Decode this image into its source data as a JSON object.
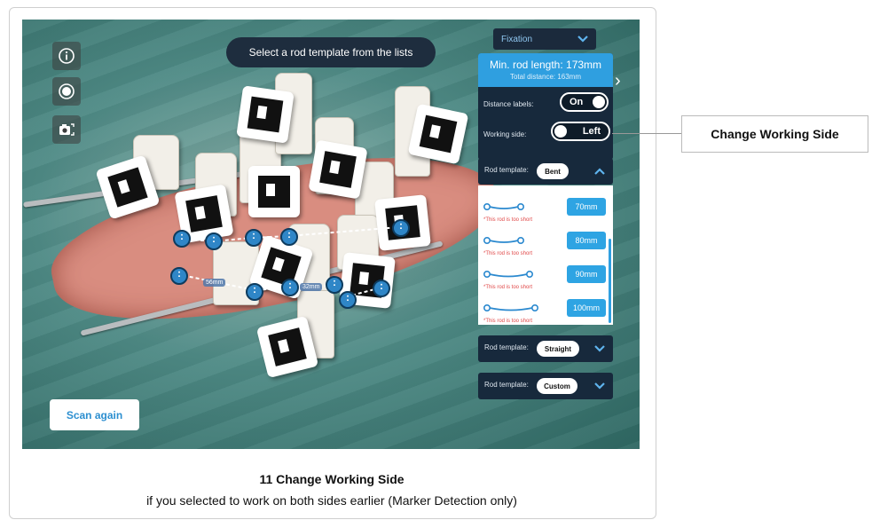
{
  "overlay": {
    "instruction": "Select a rod template from the lists",
    "fixation_dropdown": "Fixation",
    "min_rod_length": "Min. rod length: 173mm",
    "total_distance": "Total distance: 163mm",
    "distance_labels_label": "Distance labels:",
    "distance_labels_value": "On",
    "working_side_label": "Working side:",
    "working_side_value": "Left",
    "rod_template_label": "Rod template:",
    "templates": [
      "Bent",
      "Straight",
      "Custom"
    ],
    "too_short_warning": "*This rod is too short",
    "rods": [
      "70mm",
      "80mm",
      "90mm",
      "100mm"
    ],
    "scan_again": "Scan again",
    "distance_tags": [
      "56mm",
      "32mm"
    ]
  },
  "callout": {
    "label": "Change Working Side"
  },
  "caption": {
    "title": "11 Change Working Side",
    "subtitle": "if you selected to work on both sides earlier (Marker Detection only)"
  },
  "colors": {
    "panel_dark": "#17293c",
    "accent_blue": "#2f9fe0",
    "warning_red": "#e04848"
  }
}
